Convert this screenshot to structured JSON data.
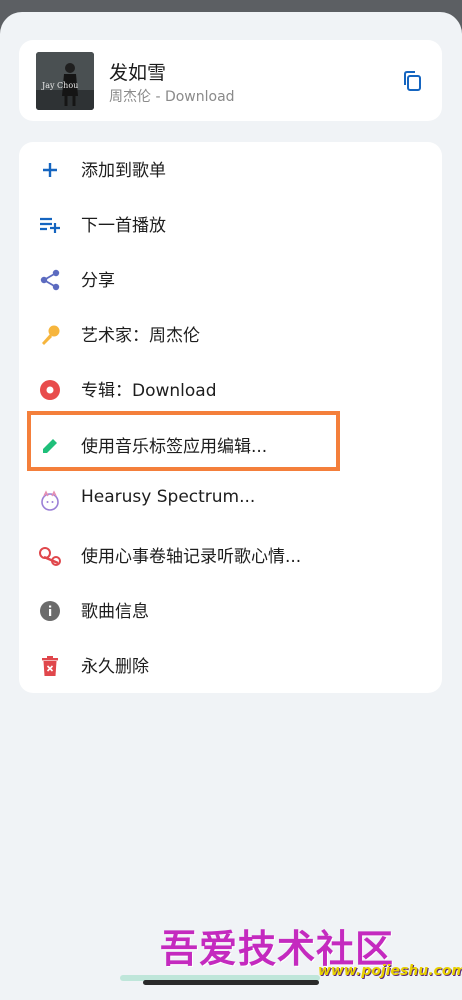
{
  "song": {
    "title": "发如雪",
    "subtitle": "周杰伦 - Download",
    "cover_text": "Jay Chou"
  },
  "menu": {
    "items": [
      {
        "label": "添加到歌单",
        "icon": "plus-icon",
        "color": "#1565c0"
      },
      {
        "label": "下一首播放",
        "icon": "playlist-add-icon",
        "color": "#1565c0"
      },
      {
        "label": "分享",
        "icon": "share-icon",
        "color": "#5c6bc0"
      },
      {
        "label": "艺术家：周杰伦",
        "icon": "microphone-icon",
        "color": "#f6b53d"
      },
      {
        "label": "专辑：Download",
        "icon": "album-icon",
        "color": "#e84c4c"
      },
      {
        "label": "使用音乐标签应用编辑...",
        "icon": "pencil-icon",
        "color": "#1fbf7a"
      },
      {
        "label": "Hearusy Spectrum...",
        "icon": "spectrum-app-icon",
        "color": "#9b7fd6"
      },
      {
        "label": "使用心事卷轴记录听歌心情...",
        "icon": "scroll-app-icon",
        "color": "#e0474c"
      },
      {
        "label": "歌曲信息",
        "icon": "info-icon",
        "color": "#6b6b6b"
      },
      {
        "label": "永久删除",
        "icon": "delete-icon",
        "color": "#e0474c"
      }
    ]
  },
  "watermark": {
    "text": "吾爱技术社区",
    "url": "www.pojieshu.com"
  },
  "colors": {
    "accent": "#1565c0",
    "highlight": "#f47f3b",
    "background": "#f0f3f6"
  }
}
